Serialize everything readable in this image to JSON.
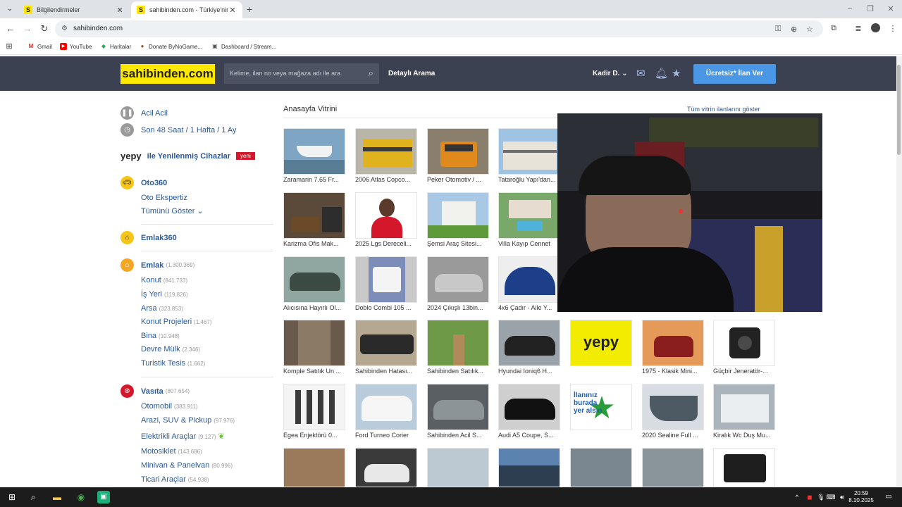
{
  "browser": {
    "tabs": [
      {
        "title": "Bilgilendirmeler"
      },
      {
        "title": "sahibinden.com - Türkiye'nin Or"
      }
    ],
    "url": "sahibinden.com",
    "bookmarks": [
      "Gmail",
      "YouTube",
      "Haritalar",
      "Donate ByNoGame...",
      "Dashboard / Stream..."
    ]
  },
  "header": {
    "logo": "sahibinden.com",
    "search_placeholder": "Kelime, ilan no veya mağaza adı ile ara",
    "detailed_search": "Detaylı Arama",
    "user": "Kadir D.",
    "post_ad": "Ücretsiz* İlan Ver"
  },
  "sidebar": {
    "top_links": [
      "Acil Acil",
      "Son 48 Saat / 1 Hafta / 1 Ay"
    ],
    "yepy": {
      "logo": "yepy",
      "text": "ile Yenilenmiş Cihazlar",
      "badge": "yeni"
    },
    "oto360": {
      "title": "Oto360",
      "items": [
        "Oto Ekspertiz",
        "Tümünü Göster"
      ]
    },
    "emlak360": {
      "title": "Emlak360"
    },
    "emlak": {
      "title": "Emlak",
      "count": "(1.300.369)",
      "items": [
        {
          "label": "Konut",
          "count": "(841.733)"
        },
        {
          "label": "İş Yeri",
          "count": "(119.826)"
        },
        {
          "label": "Arsa",
          "count": "(323.853)"
        },
        {
          "label": "Konut Projeleri",
          "count": "(1.467)"
        },
        {
          "label": "Bina",
          "count": "(10.948)"
        },
        {
          "label": "Devre Mülk",
          "count": "(2.346)"
        },
        {
          "label": "Turistik Tesis",
          "count": "(1.662)"
        }
      ]
    },
    "vasita": {
      "title": "Vasıta",
      "count": "(807.654)",
      "items": [
        {
          "label": "Otomobil",
          "count": "(383.911)"
        },
        {
          "label": "Arazi, SUV & Pickup",
          "count": "(97.976)"
        },
        {
          "label": "Elektrikli Araçlar",
          "count": "(9.127)"
        },
        {
          "label": "Motosiklet",
          "count": "(143.686)"
        },
        {
          "label": "Minivan & Panelvan",
          "count": "(80.996)"
        },
        {
          "label": "Ticari Araçlar",
          "count": "(54.938)"
        }
      ]
    }
  },
  "main": {
    "section_title": "Anasayfa Vitrini",
    "all_link": "Tüm vitrin ilanlarını göster",
    "listings": [
      [
        "Zaramarin 7.65 Fr...",
        "2006 Atlas Copco...",
        "Peker Otomotiv / ...",
        "Tataroğlu Yapı'dan..."
      ],
      [
        "Karizma Ofis Mak...",
        "2025 Lgs Dereceli...",
        "Şemsi Araç Sitesi...",
        "Villa Kayıp Cennet"
      ],
      [
        "Alıcısına Hayırlı Ol...",
        "Doblo Combi 105 ...",
        "2024 Çıkışlı 13bin...",
        "4x6 Çadır - Aile Y..."
      ],
      [
        "Komple Satılık Un ...",
        "Sahibinden Hatası...",
        "Sahibinden Satılık...",
        "Hyundai Ioniq6 H...",
        "",
        "1975 - Klasik Mini...",
        "Güçbir Jeneratör-..."
      ],
      [
        "Egea Enjektörü 0...",
        "Ford Turneo Corier",
        "Sahibinden Acil S...",
        "Audi A5 Coupe, S...",
        "",
        "2020 Sealine Full ...",
        "Kiralık Wc Duş Mu..."
      ]
    ],
    "yepy_tile": "yepy",
    "promo_tile": [
      "İlanınız",
      "burada",
      "yer alsın"
    ]
  },
  "taskbar": {
    "time": "20:59",
    "date": "8.10.2025"
  },
  "colors": {
    "header_bg": "#3b4151",
    "logo_bg": "#ffe800",
    "button_blue": "#4a97e6",
    "badge_red": "#d4172b"
  }
}
